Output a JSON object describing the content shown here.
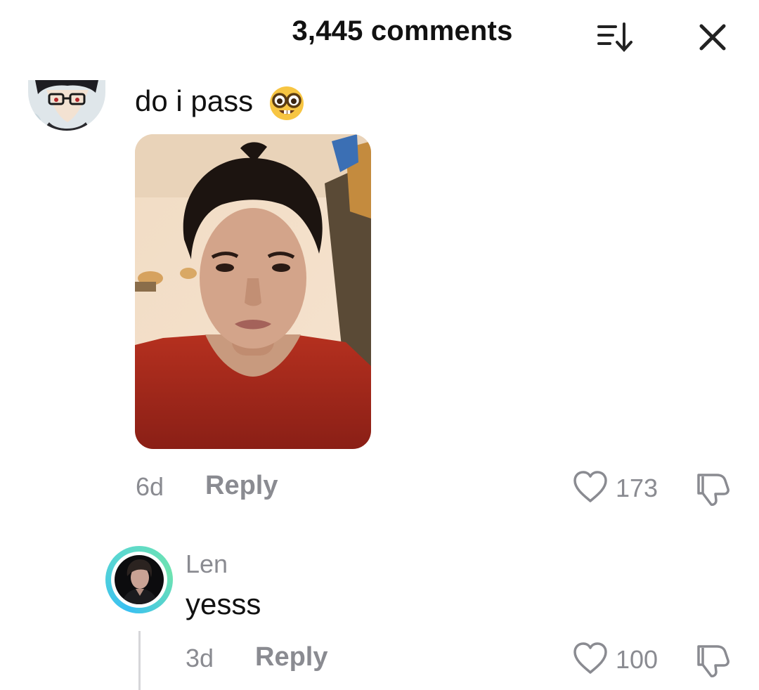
{
  "header": {
    "title": "3,445 comments"
  },
  "comment": {
    "text": "do i pass",
    "emoji": "nerd-face-emoji",
    "image_description_icon": "selfie-photo",
    "time": "6d",
    "reply_label": "Reply",
    "likes": "173"
  },
  "reply": {
    "author": "Len",
    "text": "yesss",
    "time": "3d",
    "reply_label": "Reply",
    "likes": "100"
  },
  "colors": {
    "muted": "#8a8b91",
    "text": "#111111",
    "avatar_ring_start": "#39c0f2",
    "avatar_ring_end": "#6ee3b0"
  }
}
